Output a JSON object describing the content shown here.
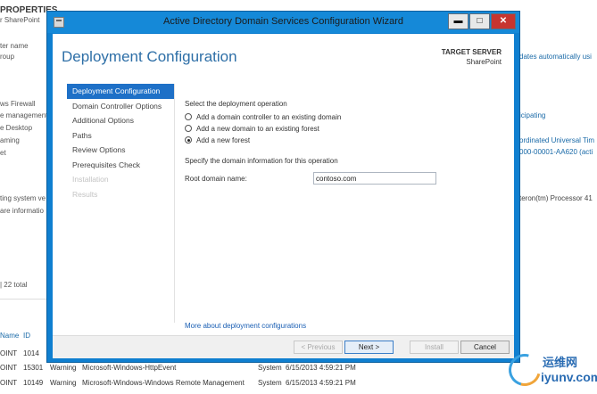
{
  "background": {
    "properties_title": "PROPERTIES",
    "properties_sub": "r SharePoint",
    "left_labels": [
      "ter name",
      "roup",
      "ws Firewall",
      "e management",
      "e Desktop",
      "aming",
      "et",
      "ting system ve",
      "are informatio"
    ],
    "right_values": [
      "dates automatically usi",
      "icipating",
      "ordinated Universal Tim",
      "000-00001-AA620 (acti",
      "teron(tm) Processor 41"
    ],
    "total": "| 22 total",
    "table_header": {
      "name": "Name",
      "id": "ID"
    },
    "rows": [
      {
        "server": "OINT",
        "id": "1014",
        "level": "",
        "source": "",
        "log": "",
        "time": ""
      },
      {
        "server": "OINT",
        "id": "15301",
        "level": "Warning",
        "source": "Microsoft-Windows-HttpEvent",
        "log": "System",
        "time": "6/15/2013 4:59:21 PM"
      },
      {
        "server": "OINT",
        "id": "10149",
        "level": "Warning",
        "source": "Microsoft-Windows-Windows Remote Management",
        "log": "System",
        "time": "6/15/2013 4:59:21 PM"
      }
    ]
  },
  "window": {
    "title": "Active Directory Domain Services Configuration Wizard",
    "minimize": "▬",
    "maximize": "□",
    "close": "✕"
  },
  "page": {
    "title": "Deployment Configuration",
    "target_heading": "TARGET SERVER",
    "target_name": "SharePoint"
  },
  "nav": {
    "items": [
      {
        "label": "Deployment Configuration",
        "state": "active"
      },
      {
        "label": "Domain Controller Options",
        "state": "normal"
      },
      {
        "label": "Additional Options",
        "state": "normal"
      },
      {
        "label": "Paths",
        "state": "normal"
      },
      {
        "label": "Review Options",
        "state": "normal"
      },
      {
        "label": "Prerequisites Check",
        "state": "normal"
      },
      {
        "label": "Installation",
        "state": "disabled"
      },
      {
        "label": "Results",
        "state": "disabled"
      }
    ]
  },
  "content": {
    "operation_label": "Select the deployment operation",
    "options": [
      {
        "label": "Add a domain controller to an existing domain",
        "selected": false
      },
      {
        "label": "Add a new domain to an existing forest",
        "selected": false
      },
      {
        "label": "Add a new forest",
        "selected": true
      }
    ],
    "domain_info_label": "Specify the domain information for this operation",
    "root_domain_label": "Root domain name:",
    "root_domain_value": "contoso.com",
    "more_link": "More about deployment configurations"
  },
  "buttons": {
    "previous": "< Previous",
    "next": "Next >",
    "install": "Install",
    "cancel": "Cancel"
  },
  "watermark": {
    "cn": "运维网",
    "url": "iyunv.com"
  },
  "colors": {
    "accent": "#1e70c7",
    "titlebar": "#1589d8",
    "link": "#1a5fb4",
    "title_text": "#2e6fa7"
  }
}
